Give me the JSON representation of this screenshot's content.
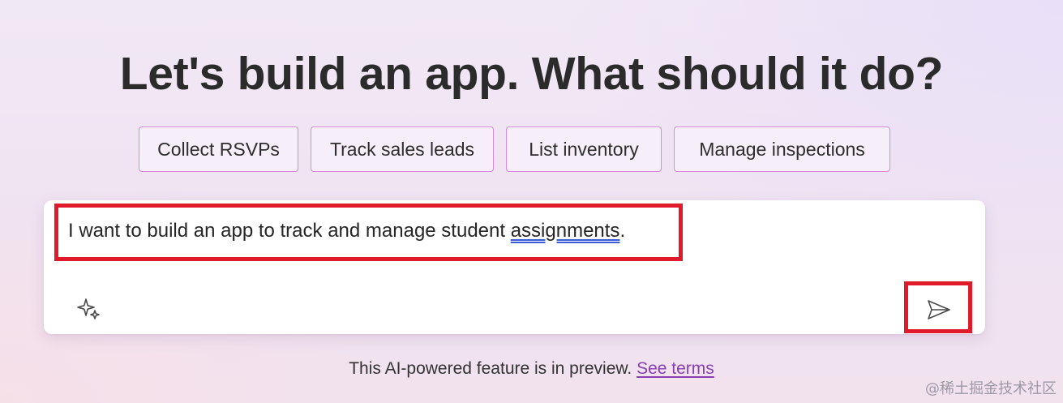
{
  "headline": "Let's build an app. What should it do?",
  "suggestions": [
    {
      "label": "Collect RSVPs"
    },
    {
      "label": "Track sales leads"
    },
    {
      "label": "List inventory"
    },
    {
      "label": "Manage inspections"
    }
  ],
  "prompt": {
    "text_before": "I want to build an app to track and manage student ",
    "misspelled_word": "assignments",
    "text_after": ".",
    "sparkle_icon": "sparkle-icon",
    "send_icon": "send-icon"
  },
  "footer": {
    "disclaimer": "This AI-powered feature is in preview.",
    "link": "See terms"
  },
  "watermark": "@稀土掘金技术社区",
  "colors": {
    "highlight_box": "#e0192b",
    "chip_border": "#d98ad6",
    "link": "#8a3fb0"
  }
}
